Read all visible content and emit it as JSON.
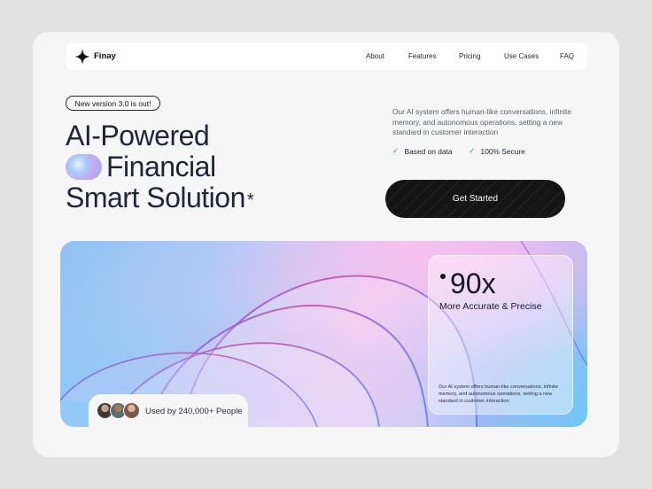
{
  "brand": {
    "name": "Finay",
    "logo_icon": "four-point-star-icon"
  },
  "nav": {
    "links": [
      {
        "label": "About"
      },
      {
        "label": "Features"
      },
      {
        "label": "Pricing"
      },
      {
        "label": "Use Cases"
      },
      {
        "label": "FAQ"
      }
    ]
  },
  "hero": {
    "badge": "New version 3.0 is out!",
    "headline_line1": "AI-Powered",
    "headline_line2": "Financial",
    "headline_line3": "Smart Solution",
    "headline_glyph": "*",
    "description": "Our AI system offers human-like conversations, infinite memory, and autonomous operations, setting a new standard in customer interaction",
    "checks": [
      {
        "label": "Based on data",
        "icon": "check-icon"
      },
      {
        "label": "100% Secure",
        "icon": "check-icon"
      }
    ],
    "cta_label": "Get Started"
  },
  "stat_card": {
    "value": "90x",
    "subtitle": "More Accurate & Precise",
    "description": "Our AI system offers human-like conversations, infinite memory, and autonomous operations, setting a new standard in customer interaction"
  },
  "users": {
    "label": "Used by 240,000+ People"
  },
  "colors": {
    "background": "#e2e2e2",
    "card": "#f6f6f6",
    "text_dark": "#1f2536",
    "button": "#141414",
    "check_green": "#3fa46a"
  }
}
